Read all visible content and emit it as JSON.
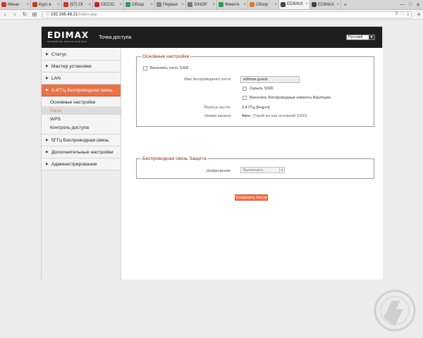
{
  "browser": {
    "tabs": [
      {
        "label": "Меню",
        "color": "#d3312c",
        "active": false
      },
      {
        "label": "Курс в",
        "color": "#c23b22",
        "active": false
      },
      {
        "label": "(57) Ot",
        "color": "#d3312c",
        "active": false
      },
      {
        "label": "GECID.",
        "color": "#cc1f1f",
        "active": false
      },
      {
        "label": "Обзор",
        "color": "#2e9e55",
        "active": false
      },
      {
        "label": "Первая",
        "color": "#888888",
        "active": false
      },
      {
        "label": "SINOP",
        "color": "#777777",
        "active": false
      },
      {
        "label": "Фините",
        "color": "#2a9c4a",
        "active": false
      },
      {
        "label": "Обзор",
        "color": "#e07a1f",
        "active": false
      },
      {
        "label": "EDIMAX",
        "color": "#444444",
        "active": true
      },
      {
        "label": "EDIMAX",
        "color": "#444444",
        "active": false
      }
    ],
    "new_tab": "+",
    "window_controls": {
      "minimize": "—",
      "maximize": "□",
      "close": "✕"
    },
    "address": {
      "host": "192.168.48.21",
      "path": "/index.asp",
      "badge_count": "0",
      "heart": "♡",
      "download": "⤓"
    },
    "menu": "≡"
  },
  "router": {
    "logo_text": "EDIMAX",
    "logo_tagline": "NETWORKING PEOPLE TOGETHER",
    "page_title": "Точка доступа",
    "language": "Русский",
    "sidebar": [
      {
        "label": "Статус",
        "active": false
      },
      {
        "label": "Мастер установки",
        "active": false
      },
      {
        "label": "LAN",
        "active": false
      },
      {
        "label": "2.4ГГц Беспроводная связь",
        "active": true
      },
      {
        "label": "5ГГц Беспроводная связь",
        "active": false
      },
      {
        "label": "Дополнительные настройки",
        "active": false
      },
      {
        "label": "Администрирование",
        "active": false
      }
    ],
    "submenu": [
      {
        "label": "Основные настройки",
        "current": false
      },
      {
        "label": "Гость",
        "current": true
      },
      {
        "label": "WPS",
        "current": false
      },
      {
        "label": "Контроль доступа",
        "current": false
      }
    ],
    "basic": {
      "legend": "Основные настройки",
      "enable_guest_ssid": "Включить гость SSID",
      "ssid_label": "Имя беспроводного гостя",
      "ssid_value": "edimax.guest",
      "hide_ssid": "Скрыть SSID",
      "isolation": "Включить Беспроводные клиенты Изоляция",
      "band_label": "Полоса частот",
      "band_value": "2.4 ГГц (b+g+n)",
      "channel_label": "Номер канала",
      "channel_value": "Авто",
      "channel_hint": "(Такой же как основной SSID)"
    },
    "security": {
      "legend": "Беспроводная связь Защита",
      "encryption_label": "Шифрование",
      "encryption_value": "Выключить"
    },
    "save_button": "Сохранить Настр"
  },
  "colors": {
    "accent": "#e8724a",
    "header_bg": "#1e1e1e",
    "legend_text": "#8a2a1a"
  }
}
